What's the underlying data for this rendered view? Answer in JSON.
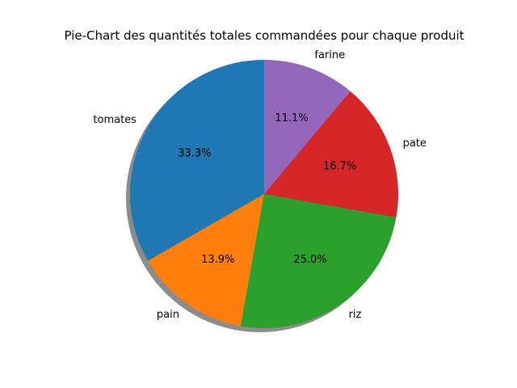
{
  "chart_data": {
    "type": "pie",
    "title": "Pie-Chart des quantités totales commandées pour chaque produit",
    "categories": [
      "tomates",
      "pain",
      "riz",
      "pate",
      "farine"
    ],
    "values": [
      33.3,
      13.9,
      25.0,
      16.7,
      11.1
    ],
    "percent_labels": [
      "33.3%",
      "13.9%",
      "25.0%",
      "16.7%",
      "11.1%"
    ],
    "colors": [
      "#1f77b4",
      "#ff7f0e",
      "#2ca02c",
      "#d62728",
      "#9467bd"
    ],
    "start_angle_deg": 90,
    "direction": "counterclockwise",
    "shadow": true
  }
}
